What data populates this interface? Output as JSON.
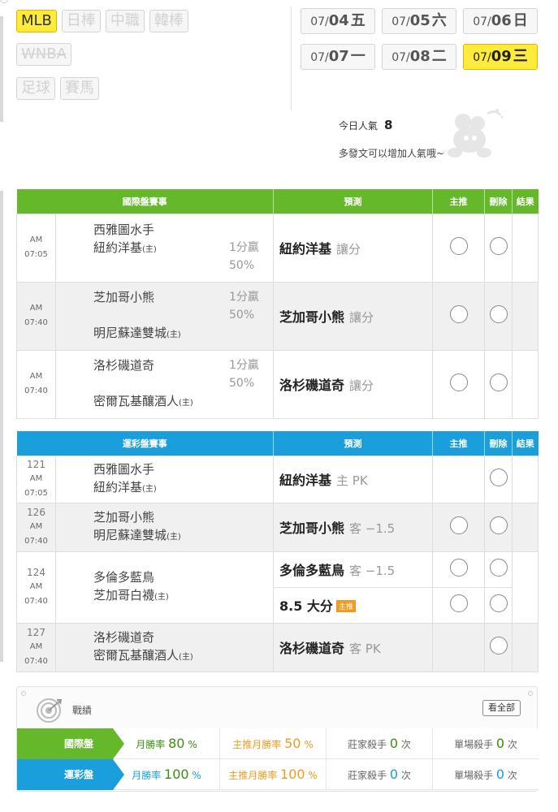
{
  "sports": {
    "row1": [
      {
        "label": "MLB",
        "active": true
      },
      {
        "label": "日棒",
        "active": false
      },
      {
        "label": "中職",
        "active": false
      },
      {
        "label": "韓棒",
        "active": false
      }
    ],
    "row2": [
      {
        "label": "WNBA",
        "active": false,
        "strike": true
      }
    ],
    "row3": [
      {
        "label": "足球",
        "active": false
      },
      {
        "label": "賽馬",
        "active": false
      }
    ]
  },
  "dates": [
    {
      "month": "07/",
      "day": "04",
      "weekday": "五",
      "active": false
    },
    {
      "month": "07/",
      "day": "05",
      "weekday": "六",
      "active": false
    },
    {
      "month": "07/",
      "day": "06",
      "weekday": "日",
      "active": false
    },
    {
      "month": "07/",
      "day": "07",
      "weekday": "一",
      "active": false
    },
    {
      "month": "07/",
      "day": "08",
      "weekday": "二",
      "active": false
    },
    {
      "month": "07/",
      "day": "09",
      "weekday": "三",
      "active": true
    }
  ],
  "popularity": {
    "label": "今日人氣",
    "count": "8",
    "tip": "多發文可以增加人氣哦~"
  },
  "intl": {
    "headers": {
      "game": "國際盤賽事",
      "pred": "預測",
      "main": "主推",
      "del": "刪除",
      "result": "結果"
    },
    "rows": [
      {
        "time": "AM 07:05",
        "away": "西雅圖水手",
        "home": "紐約洋基",
        "home_tag": "(主)",
        "odds": "1分贏 50%",
        "pick": "紐約洋基",
        "pick_sub": "讓分"
      },
      {
        "time": "AM 07:40",
        "away": "芝加哥小熊",
        "home": "明尼蘇達雙城",
        "home_tag": "(主)",
        "odds": "1分贏 50%",
        "pick": "芝加哥小熊",
        "pick_sub": "讓分"
      },
      {
        "time": "AM 07:40",
        "away": "洛杉磯道奇",
        "home": "密爾瓦基釀酒人",
        "home_tag": "(主)",
        "odds": "1分贏 50%",
        "pick": "洛杉磯道奇",
        "pick_sub": "讓分"
      }
    ]
  },
  "lottery": {
    "headers": {
      "game": "運彩盤賽事",
      "pred": "預測",
      "main": "主推",
      "del": "刪除",
      "result": "結果"
    },
    "rows": [
      {
        "id": "121",
        "time": "AM 07:05",
        "away": "西雅圖水手",
        "home": "紐約洋基",
        "home_tag": "(主)",
        "pick": "紐約洋基",
        "pick_sub": "主 PK"
      },
      {
        "id": "126",
        "time": "AM 07:40",
        "away": "芝加哥小熊",
        "home": "明尼蘇達雙城",
        "home_tag": "(主)",
        "pick": "芝加哥小熊",
        "pick_sub": "客 −1.5"
      },
      {
        "id": "124",
        "time": "AM 07:40",
        "away": "多倫多藍鳥",
        "home": "芝加哥白襪",
        "home_tag": "(主)",
        "pick": "多倫多藍鳥",
        "pick_sub": "客 −1.5",
        "pick2": "8.5 大分",
        "pick2_badge": "主推"
      },
      {
        "id": "127",
        "time": "AM 07:40",
        "away": "洛杉磯道奇",
        "home": "密爾瓦基釀酒人",
        "home_tag": "(主)",
        "pick": "洛杉磯道奇",
        "pick_sub": "客 PK"
      }
    ]
  },
  "stats": {
    "title": "戰績",
    "view_all": "看全部",
    "rows": [
      {
        "label": "國際盤",
        "month_rate_label": "月勝率",
        "month_rate": "80",
        "month_rate_unit": "%",
        "main_rate_label": "主推月勝率",
        "main_rate": "50",
        "main_rate_unit": "%",
        "house_label": "莊家殺手",
        "house": "0",
        "house_unit": "次",
        "single_label": "單場殺手",
        "single": "0",
        "single_unit": "次"
      },
      {
        "label": "運彩盤",
        "month_rate_label": "月勝率",
        "month_rate": "100",
        "month_rate_unit": "%",
        "main_rate_label": "主推月勝率",
        "main_rate": "100",
        "main_rate_unit": "%",
        "house_label": "莊家殺手",
        "house": "0",
        "house_unit": "次",
        "single_label": "單場殺手",
        "single": "0",
        "single_unit": "次"
      }
    ]
  },
  "colors": {
    "intl_green": "#64b82a",
    "lottery_blue": "#1b9edc",
    "active_yellow": "#ffeb3b",
    "orange": "#f29a1d"
  }
}
